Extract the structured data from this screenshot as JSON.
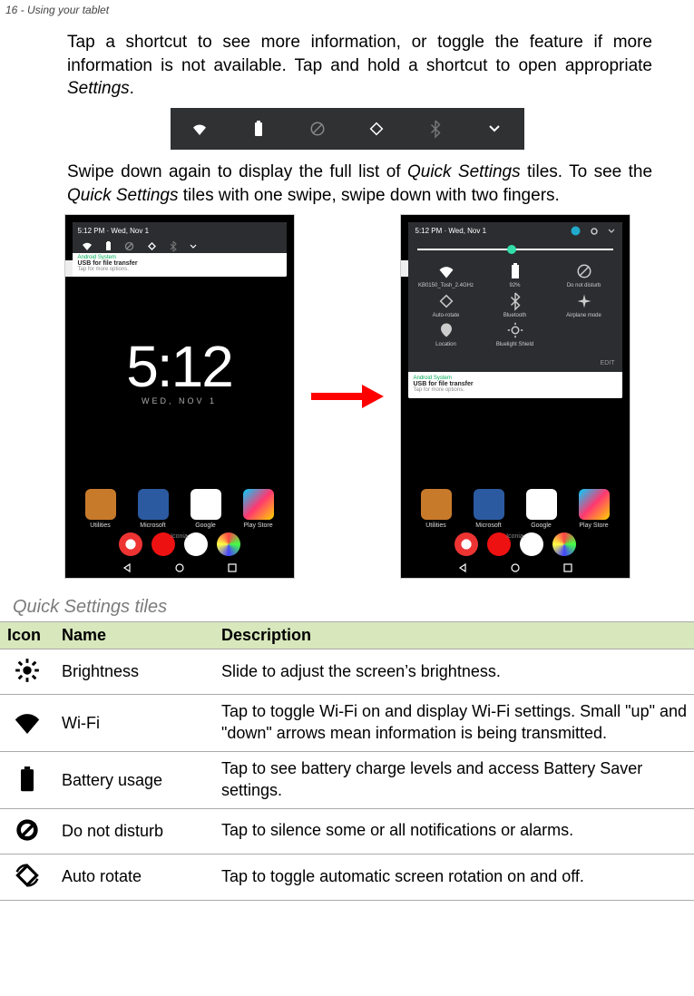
{
  "header": "16 - Using your tablet",
  "para1_pre": "Tap a shortcut to see more information, or toggle the feature if more information is not available. Tap and hold a shortcut to open appropriate ",
  "para1_ital": "Settings",
  "para1_post": ".",
  "para2_a": "Swipe down again to display the full list of ",
  "para2_b": "Quick Settings",
  "para2_c": " tiles. To see the ",
  "para2_d": "Quick Settings",
  "para2_e": " tiles with one swipe, swipe down with two fingers.",
  "section_heading": "Quick Settings tiles",
  "tbl": {
    "h_icon": "Icon",
    "h_name": "Name",
    "h_desc": "Description",
    "rows": [
      {
        "name": "Brightness",
        "desc": "Slide to adjust the screen’s brightness."
      },
      {
        "name": "Wi-Fi",
        "desc": "Tap to toggle Wi-Fi on and display Wi-Fi settings. Small \"up\" and \"down\" arrows mean information is being transmitted."
      },
      {
        "name": "Battery usage",
        "desc_pre": "Tap to see battery charge levels and access ",
        "desc_ital": "Battery Saver",
        "desc_post": " settings."
      },
      {
        "name": "Do not disturb",
        "desc": "Tap to silence some or all notifications or alarms."
      },
      {
        "name": "Auto rotate",
        "desc": "Tap to toggle automatic screen rotation on and off."
      }
    ]
  },
  "phoneL": {
    "time_label": "5:12 PM · Wed, Nov 1",
    "notif_app": "Android System",
    "notif_title": "USB for file transfer",
    "notif_sub": "Tap for more options.",
    "lock_time": "5:12",
    "lock_date": "WED, NOV 1",
    "apps": [
      "Utilities",
      "Microsoft",
      "Google",
      "Play Store"
    ],
    "brand": "Iconia"
  },
  "phoneR": {
    "time_label": "5:12 PM · Wed, Nov 1",
    "tiles": [
      {
        "label": "KB0150_Tosh_2.4GHz"
      },
      {
        "label": "92%"
      },
      {
        "label": "Do not disturb"
      },
      {
        "label": "Auto-rotate"
      },
      {
        "label": "Bluetooth"
      },
      {
        "label": "Airplane mode"
      },
      {
        "label": "Location"
      },
      {
        "label": "Bluelight Shield"
      }
    ],
    "edit": "EDIT",
    "notif_app": "Android System",
    "notif_title": "USB for file transfer",
    "notif_sub": "Tap for more options.",
    "apps": [
      "Utilities",
      "Microsoft",
      "Google",
      "Play Store"
    ],
    "brand": "Iconia"
  }
}
